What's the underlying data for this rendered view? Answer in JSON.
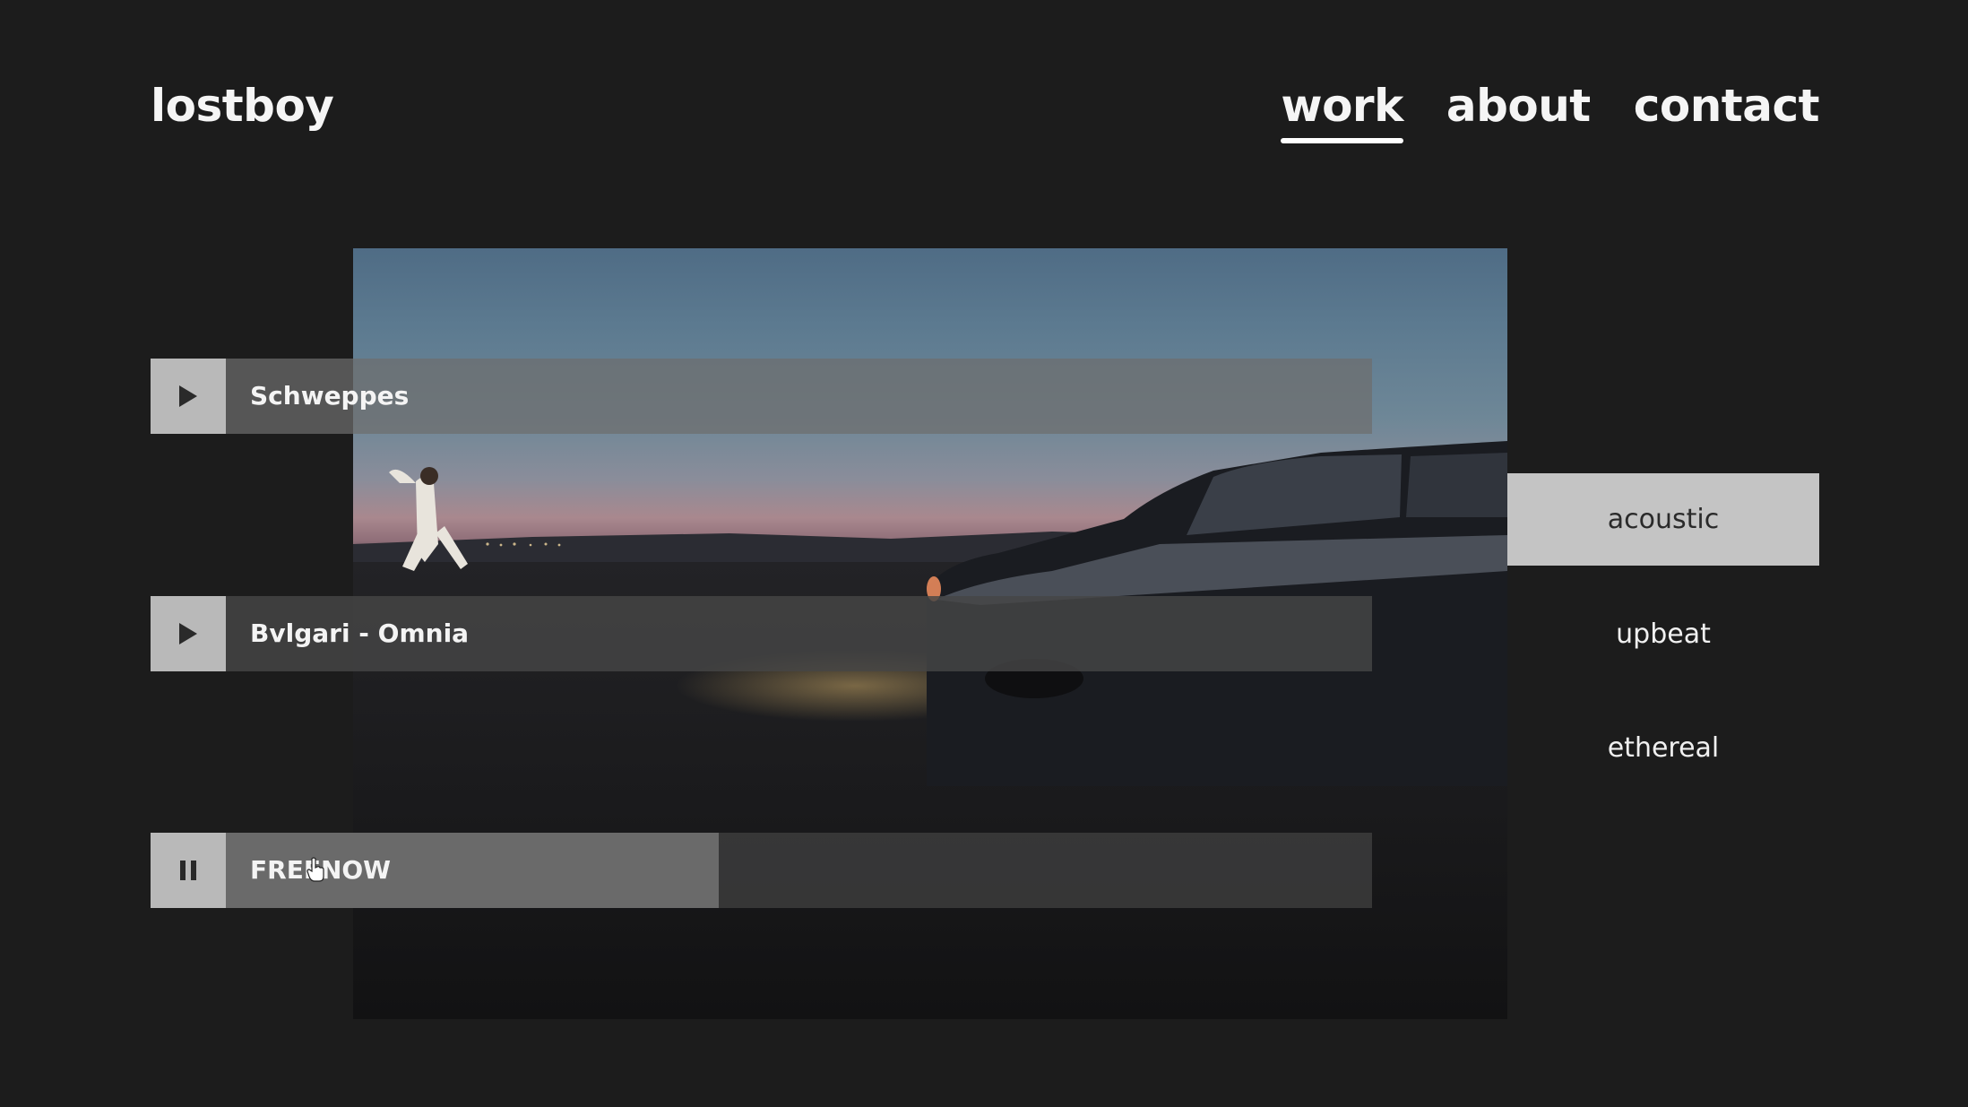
{
  "header": {
    "logo": "lostboy",
    "nav": [
      {
        "label": "work",
        "active": true
      },
      {
        "label": "about",
        "active": false
      },
      {
        "label": "contact",
        "active": false
      }
    ]
  },
  "tracks": [
    {
      "title": "Schweppes",
      "state": "paused",
      "button_icon": "play-icon"
    },
    {
      "title": "Bvlgari - Omnia",
      "state": "paused",
      "button_icon": "play-icon"
    },
    {
      "title": "FREENOW",
      "state": "playing",
      "button_icon": "pause-icon",
      "progress_percent": 43
    }
  ],
  "moods": [
    {
      "label": "acoustic",
      "active": true
    },
    {
      "label": "upbeat",
      "active": false
    },
    {
      "label": "ethereal",
      "active": false
    }
  ],
  "colors": {
    "background": "#1c1c1c",
    "button": "#b9b9b9",
    "active_mood": "#c4c4c4"
  }
}
